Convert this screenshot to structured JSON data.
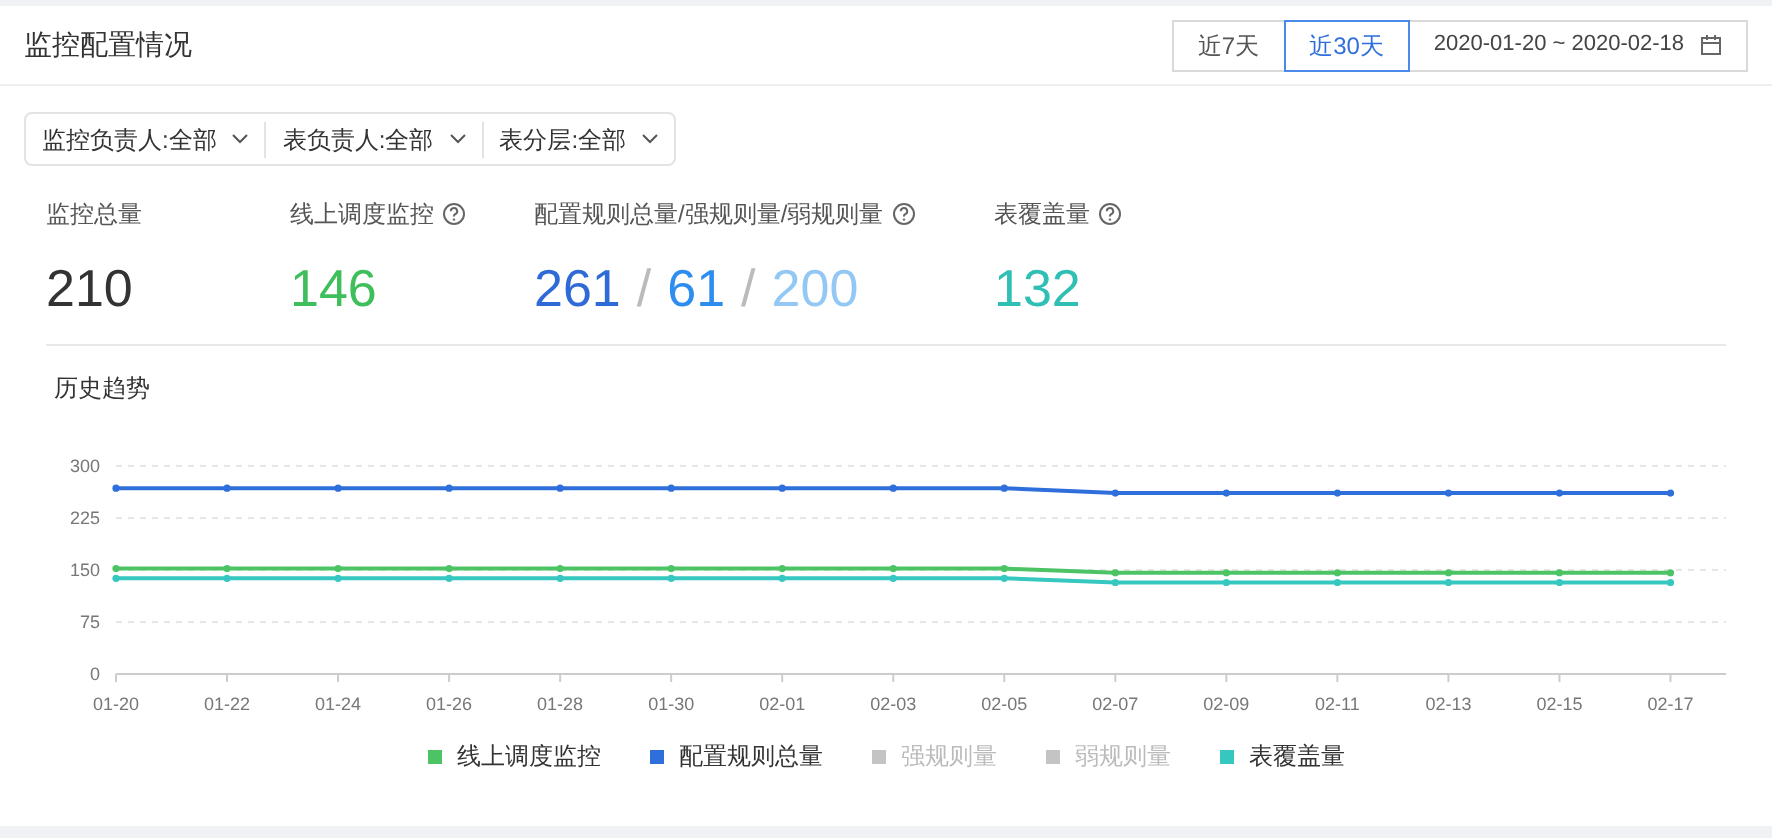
{
  "header": {
    "title": "监控配置情况",
    "range_tabs": [
      {
        "label": "近7天",
        "selected": false
      },
      {
        "label": "近30天",
        "selected": true
      }
    ],
    "date_range": "2020-01-20 ~ 2020-02-18"
  },
  "filters": [
    {
      "label": "监控负责人:全部"
    },
    {
      "label": "表负责人:全部"
    },
    {
      "label": "表分层:全部"
    }
  ],
  "stats": [
    {
      "label": "监控总量",
      "help": false,
      "values": [
        {
          "text": "210",
          "color": "#333333"
        }
      ]
    },
    {
      "label": "线上调度监控",
      "help": true,
      "values": [
        {
          "text": "146",
          "color": "#3fbf5c"
        }
      ]
    },
    {
      "label": "配置规则总量/强规则量/弱规则量",
      "help": true,
      "values": [
        {
          "text": "261",
          "color": "#2f6bd6"
        },
        {
          "text": "61",
          "color": "#2d8ef0"
        },
        {
          "text": "200",
          "color": "#93c8f5"
        }
      ],
      "separator": "/"
    },
    {
      "label": "表覆盖量",
      "help": true,
      "values": [
        {
          "text": "132",
          "color": "#2fbfb4"
        }
      ]
    }
  ],
  "trend": {
    "title": "历史趋势",
    "chart_data": {
      "type": "line",
      "grid": true,
      "legend": "bottom",
      "x": [
        "01-20",
        "01-22",
        "01-24",
        "01-26",
        "01-28",
        "01-30",
        "02-01",
        "02-03",
        "02-05",
        "02-07",
        "02-09",
        "02-11",
        "02-13",
        "02-15",
        "02-17"
      ],
      "yticks": [
        0,
        75,
        150,
        225,
        300
      ],
      "ylim": [
        0,
        300
      ],
      "series": [
        {
          "name": "线上调度监控",
          "color": "#4cc465",
          "marker": "circle",
          "values": [
            152,
            152,
            152,
            152,
            152,
            152,
            152,
            152,
            152,
            146,
            146,
            146,
            146,
            146,
            146
          ]
        },
        {
          "name": "配置规则总量",
          "color": "#2e6fdc",
          "marker": "circle",
          "values": [
            268,
            268,
            268,
            268,
            268,
            268,
            268,
            268,
            268,
            261,
            261,
            261,
            261,
            261,
            261
          ]
        },
        {
          "name": "强规则量",
          "values": [
            null,
            null,
            null,
            null,
            null,
            null,
            null,
            null,
            null,
            null,
            null,
            null,
            null,
            null,
            null
          ]
        },
        {
          "name": "弱规则量",
          "values": [
            null,
            null,
            null,
            null,
            null,
            null,
            null,
            null,
            null,
            null,
            null,
            null,
            null,
            null,
            null
          ]
        },
        {
          "name": "表覆盖量",
          "color": "#36c7c0",
          "marker": "circle",
          "values": [
            138,
            138,
            138,
            138,
            138,
            138,
            138,
            138,
            138,
            132,
            132,
            132,
            132,
            132,
            132
          ]
        }
      ]
    }
  }
}
